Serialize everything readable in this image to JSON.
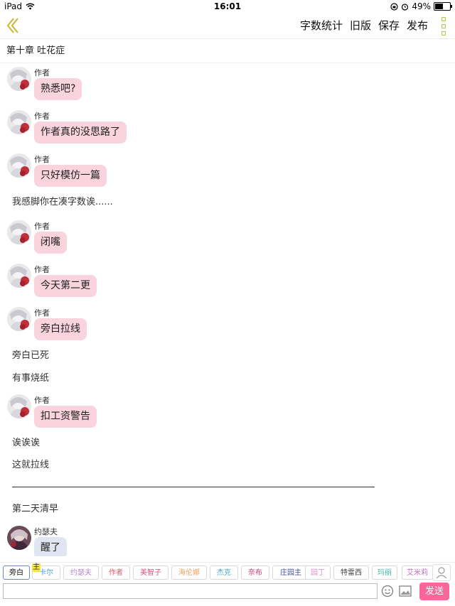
{
  "status_bar": {
    "device": "iPad",
    "time": "16:01",
    "battery": "49%"
  },
  "nav": {
    "actions": [
      "字数统计",
      "旧版",
      "保存",
      "发布"
    ]
  },
  "chapter_title": "第十章 吐花症",
  "messages": [
    {
      "kind": "bubble",
      "speaker": "作者",
      "text": "熟悉吧?"
    },
    {
      "kind": "bubble",
      "speaker": "作者",
      "text": "作者真的没思路了"
    },
    {
      "kind": "bubble",
      "speaker": "作者",
      "text": "只好模仿一篇"
    },
    {
      "kind": "narration",
      "text": "我感脚你在凑字数诶......"
    },
    {
      "kind": "bubble",
      "speaker": "作者",
      "text": "闭嘴"
    },
    {
      "kind": "bubble",
      "speaker": "作者",
      "text": "今天第二更"
    },
    {
      "kind": "bubble",
      "speaker": "作者",
      "text": "旁白拉线"
    },
    {
      "kind": "narration",
      "text": "旁白已死"
    },
    {
      "kind": "narration",
      "text": "有事烧纸"
    },
    {
      "kind": "bubble",
      "speaker": "作者",
      "text": "扣工资警告"
    },
    {
      "kind": "narration",
      "text": "诶诶诶"
    },
    {
      "kind": "narration",
      "text": "这就拉线"
    },
    {
      "kind": "divider"
    },
    {
      "kind": "narration",
      "text": "第二天清早"
    },
    {
      "kind": "bubble",
      "speaker": "约瑟夫",
      "text": "醒了"
    }
  ],
  "character_badge": "主",
  "characters": [
    {
      "label": "旁白",
      "color": "#111111",
      "selected": true
    },
    {
      "label": "卡尔",
      "color": "#4aa3c8"
    },
    {
      "label": "约瑟夫",
      "color": "#b08ac8"
    },
    {
      "label": "作者",
      "color": "#e0566a"
    },
    {
      "label": "美智子",
      "color": "#d9507c"
    },
    {
      "label": "海伦娜",
      "color": "#f0a060"
    },
    {
      "label": "杰克",
      "color": "#4aa3c8"
    },
    {
      "label": "奈布",
      "color": "#c8407a"
    },
    {
      "label": "庄园主",
      "color": "#405090"
    },
    {
      "label": "园丁",
      "color": "#d890c8"
    },
    {
      "label": "特雷西",
      "color": "#444444"
    },
    {
      "label": "玛丽",
      "color": "#40b0a8"
    },
    {
      "label": "艾米莉",
      "color": "#c070c0"
    }
  ],
  "input": {
    "value": ""
  },
  "send_label": "发送"
}
